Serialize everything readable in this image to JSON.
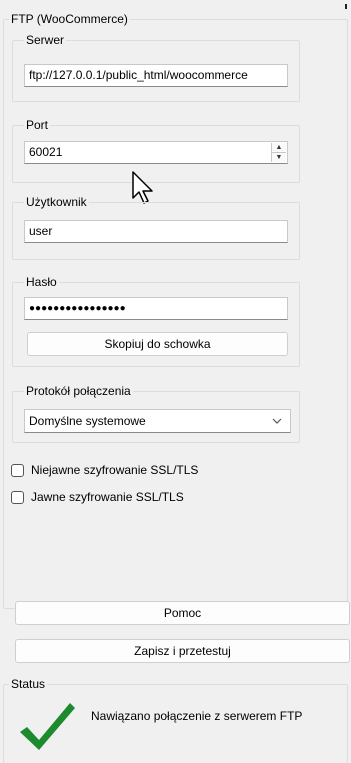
{
  "ftp": {
    "group_title": "FTP (WooCommerce)",
    "server": {
      "label": "Serwer",
      "value": "ftp://127.0.0.1/public_html/woocommerce"
    },
    "port": {
      "label": "Port",
      "value": "60021"
    },
    "user": {
      "label": "Użytkownik",
      "value": "user"
    },
    "password": {
      "label": "Hasło",
      "value": "●●●●●●●●●●●●●●●●",
      "copy_button": "Skopiuj do schowka"
    },
    "protocol": {
      "label": "Protokół połączenia",
      "selected": "Domyślne systemowe"
    },
    "implicit_ssl": {
      "label": "Niejawne szyfrowanie SSL/TLS",
      "checked": false
    },
    "explicit_ssl": {
      "label": "Jawne szyfrowanie SSL/TLS",
      "checked": false
    }
  },
  "buttons": {
    "help": "Pomoc",
    "save_test": "Zapisz i przetestuj"
  },
  "status": {
    "label": "Status",
    "message": "Nawiązano połączenie z serwerem FTP",
    "success_color": "#1e8a2e"
  }
}
